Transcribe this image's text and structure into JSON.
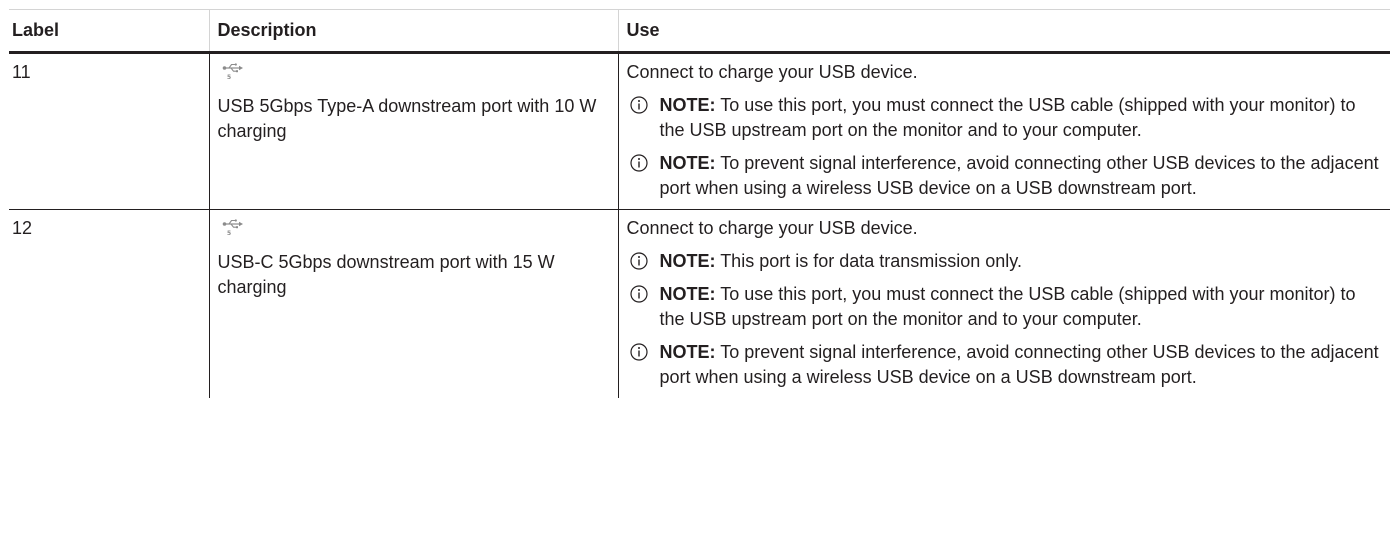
{
  "table": {
    "headers": {
      "label": "Label",
      "description": "Description",
      "use": "Use"
    },
    "rows": [
      {
        "label": "11",
        "port_icon": "usb-5gbps-icon",
        "port_icon_caption": "5",
        "description": "USB 5Gbps Type-A downstream port with 10 W charging",
        "use_text": "Connect to charge your USB device.",
        "notes": [
          {
            "label": "NOTE:",
            "text": "To use this port, you must connect the USB cable (shipped with your monitor) to the USB upstream port on the monitor and to your computer."
          },
          {
            "label": "NOTE:",
            "text": "To prevent signal interference, avoid connecting other USB devices to the adjacent port when using a wireless USB device on a USB downstream port."
          }
        ]
      },
      {
        "label": "12",
        "port_icon": "usb-5gbps-icon",
        "port_icon_caption": "5",
        "description": "USB-C 5Gbps downstream port with 15 W charging",
        "use_text": "Connect to charge your USB device.",
        "notes": [
          {
            "label": "NOTE:",
            "text": "This port is for data transmission only."
          },
          {
            "label": "NOTE:",
            "text": "To use this port, you must connect the USB cable (shipped with your monitor) to the USB upstream port on the monitor and to your computer."
          },
          {
            "label": "NOTE:",
            "text": "To prevent signal interference, avoid connecting other USB devices to the adjacent port when using a wireless USB device on a USB downstream port."
          }
        ]
      }
    ]
  },
  "colors": {
    "text": "#231f20",
    "icon": "#8c8c8c",
    "rule": "#231f20",
    "header_top_border": "#d4d4d4"
  }
}
